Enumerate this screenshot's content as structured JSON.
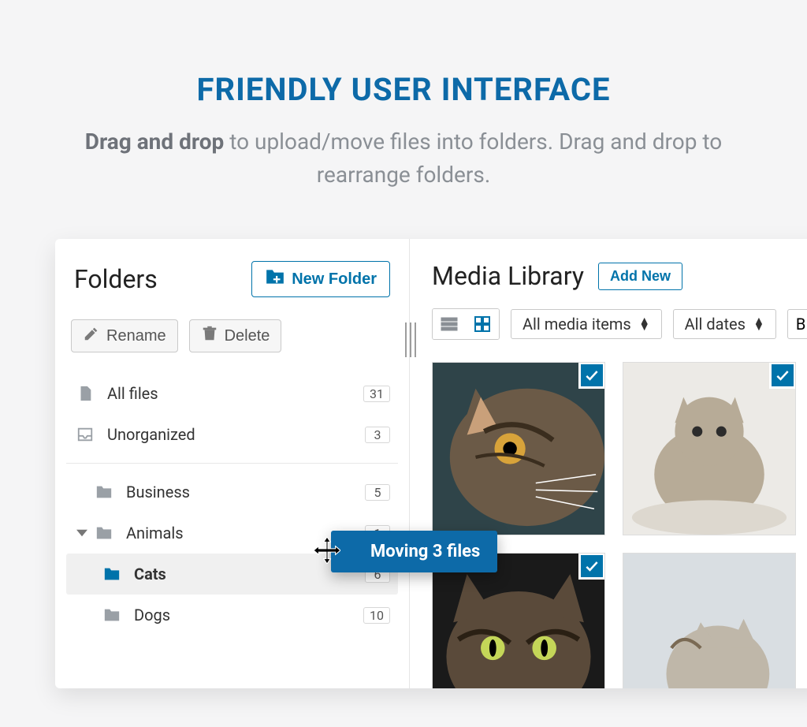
{
  "hero": {
    "title": "FRIENDLY USER INTERFACE",
    "sub_bold": "Drag and drop",
    "sub_rest": " to upload/move files into folders. Drag and drop to rearrange folders."
  },
  "sidebar": {
    "title": "Folders",
    "new_folder": "New Folder",
    "rename": "Rename",
    "delete": "Delete",
    "items": {
      "all_files": {
        "label": "All files",
        "count": "31"
      },
      "unorganized": {
        "label": "Unorganized",
        "count": "3"
      },
      "business": {
        "label": "Business",
        "count": "5"
      },
      "animals": {
        "label": "Animals",
        "count": "1"
      },
      "cats": {
        "label": "Cats",
        "count": "6"
      },
      "dogs": {
        "label": "Dogs",
        "count": "10"
      }
    }
  },
  "main": {
    "title": "Media Library",
    "add_new": "Add New",
    "filter_media": "All media items",
    "filter_dates": "All dates",
    "bulk_initial": "B"
  },
  "drag": {
    "label": "Moving 3 files"
  }
}
